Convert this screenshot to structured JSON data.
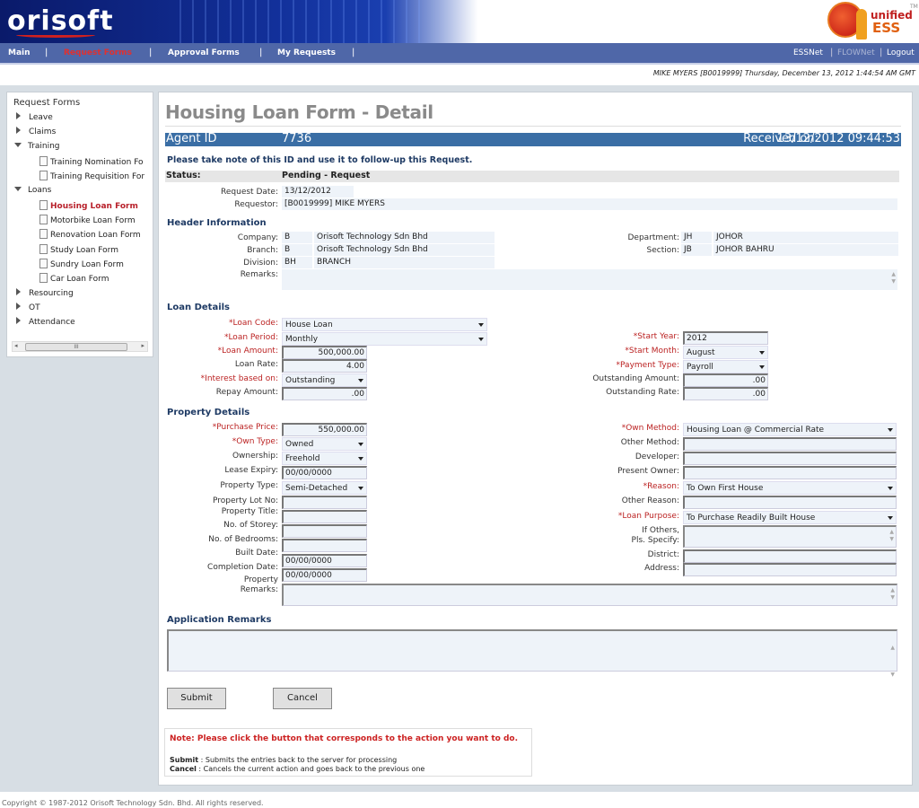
{
  "header": {
    "logo": "orisoft",
    "ess_logo": {
      "top": "unified",
      "bottom": "ESS",
      "tm": "TM"
    }
  },
  "nav": {
    "items": [
      {
        "label": "Main",
        "active": false
      },
      {
        "label": "Request Forms",
        "active": true
      },
      {
        "label": "Approval Forms",
        "active": false
      },
      {
        "label": "My Requests",
        "active": false
      }
    ],
    "right": [
      {
        "label": "ESSNet",
        "disabled": false
      },
      {
        "label": "FLOWNet",
        "disabled": true
      },
      {
        "label": "Logout",
        "disabled": false
      }
    ],
    "separator": "|"
  },
  "user_line": "MIKE MYERS [B0019999] Thursday, December 13, 2012 1:44:54 AM GMT",
  "sidebar": {
    "title": "Request Forms",
    "items": [
      {
        "label": "Leave",
        "level": 0,
        "expanded": false
      },
      {
        "label": "Claims",
        "level": 0,
        "expanded": false
      },
      {
        "label": "Training",
        "level": 0,
        "expanded": true
      },
      {
        "label": "Training Nomination Fo",
        "level": 1
      },
      {
        "label": "Training Requisition For",
        "level": 1
      },
      {
        "label": "Loans",
        "level": 0,
        "expanded": true
      },
      {
        "label": "Housing Loan Form",
        "level": 1,
        "active": true
      },
      {
        "label": "Motorbike Loan Form",
        "level": 1
      },
      {
        "label": "Renovation Loan Form",
        "level": 1
      },
      {
        "label": "Study Loan Form",
        "level": 1
      },
      {
        "label": "Sundry Loan Form",
        "level": 1
      },
      {
        "label": "Car Loan Form",
        "level": 1
      },
      {
        "label": "Resourcing",
        "level": 0,
        "expanded": false
      },
      {
        "label": "OT",
        "level": 0,
        "expanded": false
      },
      {
        "label": "Attendance",
        "level": 0,
        "expanded": false
      }
    ],
    "scroll_grip": "III"
  },
  "page": {
    "title": "Housing Loan Form - Detail",
    "agent_id_label": "Agent ID",
    "agent_id": "7736",
    "received_label": "Received on:",
    "received": "13/12/2012 09:44:53",
    "note_id": "Please take note of this ID and use it to follow-up this Request.",
    "status_label": "Status:",
    "status": "Pending - Request",
    "request_date_label": "Request Date:",
    "request_date": "13/12/2012",
    "requestor_label": "Requestor:",
    "requestor": "[B0019999] MIKE MYERS"
  },
  "header_info": {
    "heading": "Header Information",
    "left": [
      {
        "label": "Company:",
        "code": "B",
        "desc": "Orisoft Technology Sdn Bhd"
      },
      {
        "label": "Branch:",
        "code": "B",
        "desc": "Orisoft Technology Sdn Bhd"
      },
      {
        "label": "Division:",
        "code": "BH",
        "desc": "BRANCH"
      }
    ],
    "right": [
      {
        "label": "Department:",
        "code": "JH",
        "desc": "JOHOR"
      },
      {
        "label": "Section:",
        "code": "JB",
        "desc": "JOHOR BAHRU"
      }
    ],
    "remarks_label": "Remarks:",
    "remarks": ""
  },
  "loan_details": {
    "heading": "Loan Details",
    "left": [
      {
        "label": "*Loan Code:",
        "value": "House Loan",
        "kind": "select",
        "required": true
      },
      {
        "label": "*Loan Period:",
        "value": "Monthly",
        "kind": "select",
        "required": true
      },
      {
        "label": "*Loan Amount:",
        "value": "500,000.00",
        "kind": "num",
        "required": true
      },
      {
        "label": "Loan Rate:",
        "value": "4.00",
        "kind": "num"
      },
      {
        "label": "*Interest based on:",
        "value": "Outstanding",
        "kind": "select",
        "required": true
      },
      {
        "label": "Repay Amount:",
        "value": ".00",
        "kind": "num"
      }
    ],
    "right": [
      {
        "label": "*Start Year:",
        "value": "2012",
        "kind": "text",
        "required": true
      },
      {
        "label": "*Start Month:",
        "value": "August",
        "kind": "select",
        "required": true
      },
      {
        "label": "*Payment Type:",
        "value": "Payroll",
        "kind": "select",
        "required": true
      },
      {
        "label": "Outstanding Amount:",
        "value": ".00",
        "kind": "num"
      },
      {
        "label": "Outstanding Rate:",
        "value": ".00",
        "kind": "num"
      }
    ]
  },
  "property_details": {
    "heading": "Property Details",
    "left": [
      {
        "label": "*Purchase Price:",
        "value": "550,000.00",
        "kind": "num",
        "required": true
      },
      {
        "label": "*Own Type:",
        "value": "Owned",
        "kind": "select",
        "required": true
      },
      {
        "label": "Ownership:",
        "value": "Freehold",
        "kind": "select"
      },
      {
        "label": "Lease Expiry:",
        "value": "00/00/0000",
        "kind": "text"
      },
      {
        "label": "Property Type:",
        "value": "Semi-Detached",
        "kind": "select"
      },
      {
        "label": "Property Lot No:",
        "value": "",
        "kind": "text"
      },
      {
        "label": "Property Title:",
        "value": "",
        "kind": "text"
      },
      {
        "label": "No. of Storey:",
        "value": "",
        "kind": "text"
      },
      {
        "label": "No. of Bedrooms:",
        "value": "",
        "kind": "text"
      },
      {
        "label": "Built Date:",
        "value": "00/00/0000",
        "kind": "text"
      },
      {
        "label": "Completion Date:",
        "value": "00/00/0000",
        "kind": "text"
      }
    ],
    "remarks_label_1": "Property",
    "remarks_label_2": "Remarks:",
    "remarks": "",
    "right": [
      {
        "label": "*Own Method:",
        "value": "Housing Loan @ Commercial Rate",
        "kind": "select",
        "required": true
      },
      {
        "label": "Other Method:",
        "value": "",
        "kind": "text"
      },
      {
        "label": "Developer:",
        "value": "",
        "kind": "text"
      },
      {
        "label": "Present Owner:",
        "value": "",
        "kind": "text"
      },
      {
        "label": "*Reason:",
        "value": "To Own First House",
        "kind": "select",
        "required": true
      },
      {
        "label": "Other Reason:",
        "value": "",
        "kind": "text"
      },
      {
        "label": "*Loan Purpose:",
        "value": "To Purchase Readily Built House",
        "kind": "select",
        "required": true
      },
      {
        "label": "If Others,\nPls. Specify:",
        "value": "",
        "kind": "textarea"
      },
      {
        "label": "District:",
        "value": "",
        "kind": "text"
      },
      {
        "label": "Address:",
        "value": "",
        "kind": "text"
      }
    ]
  },
  "application_remarks": {
    "heading": "Application Remarks",
    "value": ""
  },
  "buttons": {
    "submit": "Submit",
    "cancel": "Cancel"
  },
  "note": {
    "title": "Note: Please click the button that corresponds to the action you want to do.",
    "lines": [
      {
        "key": "Submit",
        "text": ": Submits the entries back to the server for processing"
      },
      {
        "key": "Cancel",
        "text": " : Cancels the current action and goes back to the previous one"
      }
    ]
  },
  "footer": "Copyright © 1987-2012 Orisoft Technology Sdn. Bhd. All rights reserved.",
  "colors": {
    "nav_bg": "#4f67a8",
    "id_bar": "#3a6ea5",
    "required": "#b22222",
    "active_nav": "#e03030",
    "heading": "#1e3a64"
  }
}
